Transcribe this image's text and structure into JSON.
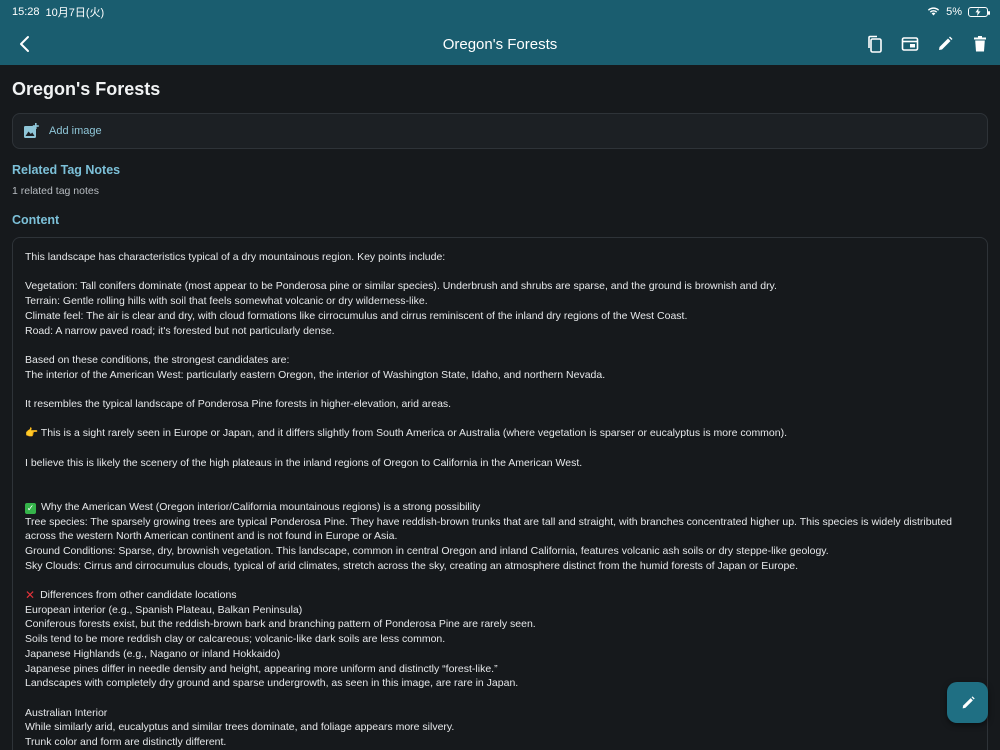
{
  "status_bar": {
    "time": "15:28",
    "date": "10月7日(火)",
    "battery_percent": "5%"
  },
  "nav": {
    "title": "Oregon's Forests",
    "actions": [
      "copy-icon",
      "split-view-icon",
      "edit-icon",
      "delete-icon"
    ]
  },
  "note": {
    "title": "Oregon's Forests",
    "add_image_label": "Add image",
    "related_heading": "Related Tag Notes",
    "related_count_text": "1 related tag notes",
    "content_heading": "Content",
    "content_lines": [
      "This landscape has characteristics typical of a dry mountainous region. Key points include:",
      "",
      "Vegetation: Tall conifers dominate (most appear to be Ponderosa pine or similar species). Underbrush and shrubs are sparse, and the ground is brownish and dry.",
      "Terrain: Gentle rolling hills with soil that feels somewhat volcanic or dry wilderness-like.",
      "Climate feel: The air is clear and dry, with cloud formations like cirrocumulus and cirrus reminiscent of the inland dry regions of the West Coast.",
      "Road: A narrow paved road; it's forested but not particularly dense.",
      "",
      "Based on these conditions, the strongest candidates are:",
      "The interior of the American West: particularly eastern Oregon, the interior of Washington State, Idaho, and northern Nevada.",
      "",
      "It resembles the typical landscape of Ponderosa Pine forests in higher-elevation, arid areas.",
      "",
      "👉 This is a sight rarely seen in Europe or Japan, and it differs slightly from South America or Australia (where vegetation is sparser or eucalyptus is more common).",
      "",
      "I believe this is likely the scenery of the high plateaus in the inland regions of Oregon to California in the American West.",
      "",
      "",
      "✅ Why the American West (Oregon interior/California mountainous regions) is a strong possibility",
      "Tree species: The sparsely growing trees are typical Ponderosa Pine. They have reddish-brown trunks that are tall and straight, with branches concentrated higher up. This species is widely distributed across the western North American continent and is not found in Europe or Asia.",
      "Ground Conditions: Sparse, dry, brownish vegetation. This landscape, common in central Oregon and inland California, features volcanic ash soils or dry steppe-like geology.",
      "Sky Clouds: Cirrus and cirrocumulus clouds, typical of arid climates, stretch across the sky, creating an atmosphere distinct from the humid forests of Japan or Europe.",
      "",
      "❌ Differences from other candidate locations",
      "European interior (e.g., Spanish Plateau, Balkan Peninsula)",
      "Coniferous forests exist, but the reddish-brown bark and branching pattern of Ponderosa Pine are rarely seen.",
      "Soils tend to be more reddish clay or calcareous; volcanic-like dark soils are less common.",
      "Japanese Highlands (e.g., Nagano or inland Hokkaido)",
      "Japanese pines differ in needle density and height, appearing more uniform and distinctly “forest-like.”",
      "Landscapes with completely dry ground and sparse undergrowth, as seen in this image, are rare in Japan.",
      "",
      "Australian Interior",
      "While similarly arid, eucalyptus and similar trees dominate, and foliage appears more silvery.",
      "Trunk color and form are distinctly different."
    ]
  },
  "fab": {
    "icon": "edit-icon"
  },
  "colors": {
    "header_bg": "#1a5d6f",
    "page_bg": "#16191c",
    "accent_heading": "#7cc0d8",
    "fab_bg": "#1f6f83"
  }
}
